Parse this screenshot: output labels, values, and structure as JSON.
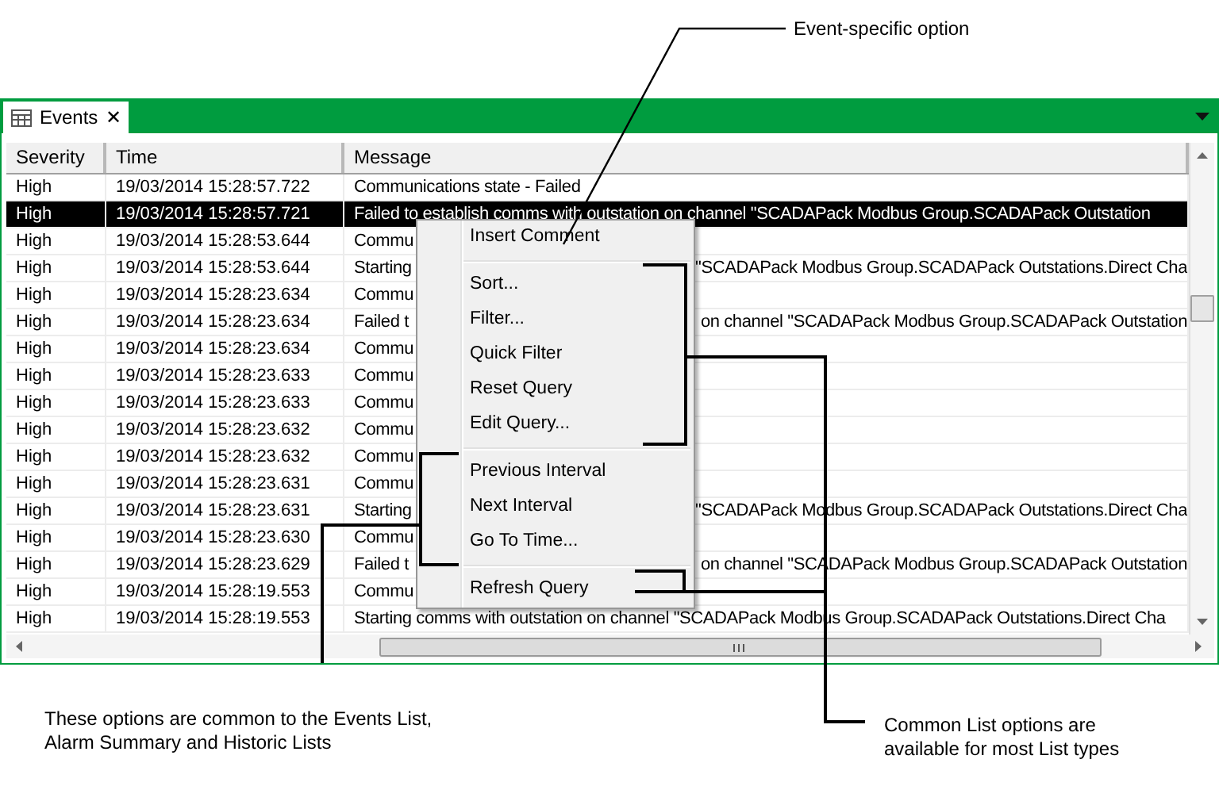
{
  "tab": {
    "label": "Events",
    "close": "✕",
    "selected": true
  },
  "columns": [
    "Severity",
    "Time",
    "Message"
  ],
  "rows": [
    {
      "severity": "High",
      "time": "19/03/2014 15:28:57.722",
      "message": "Communications state - Failed",
      "selected": false
    },
    {
      "severity": "High",
      "time": "19/03/2014 15:28:57.721",
      "message": "Failed to establish comms with outstation on channel \"SCADAPack Modbus Group.SCADAPack Outstation",
      "selected": true
    },
    {
      "severity": "High",
      "time": "19/03/2014 15:28:53.644",
      "message": "Commu",
      "selected": false
    },
    {
      "severity": "High",
      "time": "19/03/2014 15:28:53.644",
      "message": "Starting",
      "message_right": "\"SCADAPack Modbus Group.SCADAPack Outstations.Direct Cha",
      "selected": false
    },
    {
      "severity": "High",
      "time": "19/03/2014 15:28:23.634",
      "message": "Commu",
      "selected": false
    },
    {
      "severity": "High",
      "time": "19/03/2014 15:28:23.634",
      "message": "Failed t",
      "message_right": "on channel \"SCADAPack Modbus Group.SCADAPack Outstation",
      "selected": false
    },
    {
      "severity": "High",
      "time": "19/03/2014 15:28:23.634",
      "message": "Commu",
      "selected": false
    },
    {
      "severity": "High",
      "time": "19/03/2014 15:28:23.633",
      "message": "Commu",
      "selected": false
    },
    {
      "severity": "High",
      "time": "19/03/2014 15:28:23.633",
      "message": "Commu",
      "selected": false
    },
    {
      "severity": "High",
      "time": "19/03/2014 15:28:23.632",
      "message": "Commu",
      "selected": false
    },
    {
      "severity": "High",
      "time": "19/03/2014 15:28:23.632",
      "message": "Commu",
      "selected": false
    },
    {
      "severity": "High",
      "time": "19/03/2014 15:28:23.631",
      "message": "Commu",
      "selected": false
    },
    {
      "severity": "High",
      "time": "19/03/2014 15:28:23.631",
      "message": "Starting",
      "message_right": "\"SCADAPack Modbus Group.SCADAPack Outstations.Direct Cha",
      "selected": false
    },
    {
      "severity": "High",
      "time": "19/03/2014 15:28:23.630",
      "message": "Commu",
      "selected": false
    },
    {
      "severity": "High",
      "time": "19/03/2014 15:28:23.629",
      "message": "Failed t",
      "message_right": "on channel \"SCADAPack Modbus Group.SCADAPack Outstation",
      "selected": false
    },
    {
      "severity": "High",
      "time": "19/03/2014 15:28:19.553",
      "message": "Commu",
      "selected": false
    },
    {
      "severity": "High",
      "time": "19/03/2014 15:28:19.553",
      "message": "Starting comms with outstation on channel \"SCADAPack Modbus Group.SCADAPack Outstations.Direct Cha",
      "selected": false
    }
  ],
  "context_menu": {
    "groups": [
      [
        "Insert Comment"
      ],
      [
        "Sort...",
        "Filter...",
        "Quick Filter",
        "Reset Query",
        "Edit Query..."
      ],
      [
        "Previous Interval",
        "Next Interval",
        "Go To Time..."
      ],
      [
        "Refresh Query"
      ]
    ]
  },
  "callouts": [
    {
      "kind": "top",
      "lines": [
        "Event-specific option"
      ]
    },
    {
      "kind": "left",
      "lines": [
        "These options are common to the Events List,",
        "Alarm Summary and Historic Lists"
      ]
    },
    {
      "kind": "right",
      "lines": [
        "Common List options are",
        "available for most List types"
      ]
    }
  ]
}
